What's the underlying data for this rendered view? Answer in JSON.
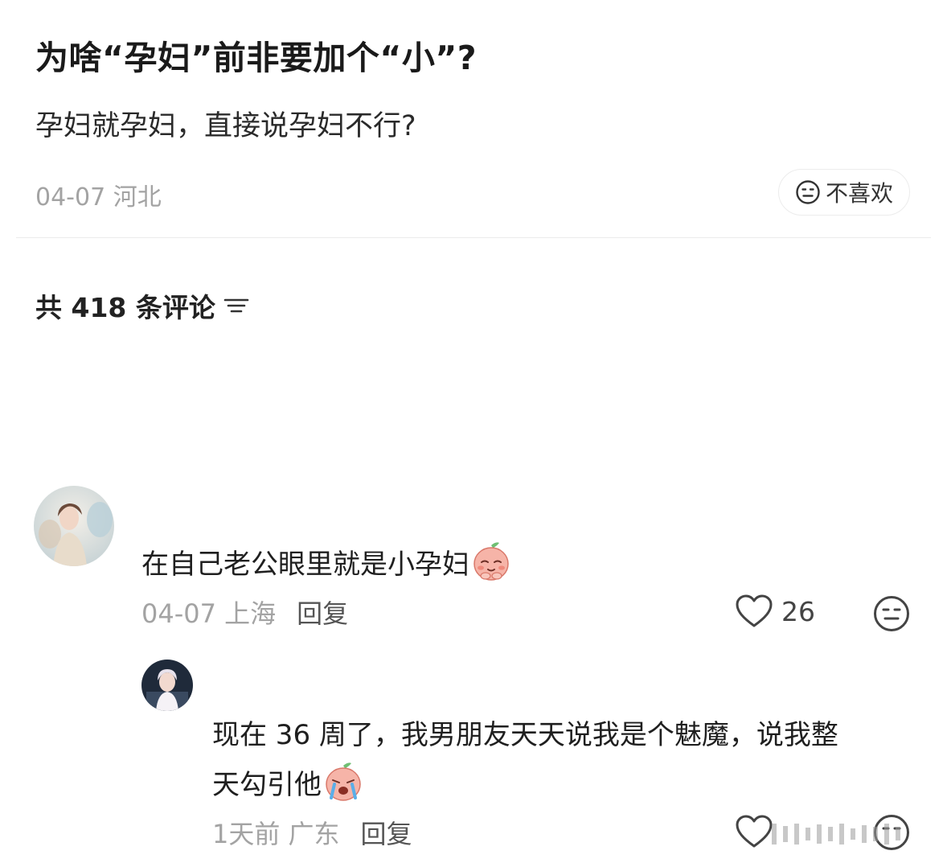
{
  "post": {
    "title": "为啥“孕妇”前非要加个“小”?",
    "body": "孕妇就孕妇，直接说孕妇不行?",
    "meta": "04-07 河北",
    "dislike_label": "不喜欢"
  },
  "comments_header": {
    "label": "共 418 条评论"
  },
  "comments": [
    {
      "text": "在自己老公眼里就是小孕妇",
      "emoji": "shy-peach-emoji",
      "meta": "04-07 上海",
      "reply_label": "回复",
      "likes": "26"
    },
    {
      "text_line1": "现在 36 周了，我男朋友天天说我是个魅魔，说我整",
      "text_line2": "天勾引他",
      "emoji": "crying-peach-emoji",
      "meta": "1天前 广东",
      "reply_label": "回复"
    }
  ],
  "colors": {
    "text_primary": "#1a1a1a",
    "text_secondary": "#a3a3a3",
    "divider": "#ececec"
  }
}
